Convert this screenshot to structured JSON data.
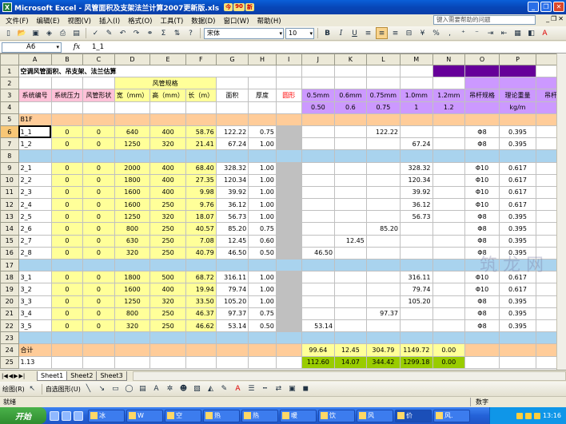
{
  "window": {
    "title": "Microsoft Excel - 风管面积及支架法兰计算2007更新版.xls",
    "badges": [
      "今",
      "90",
      "新"
    ]
  },
  "menu": [
    "文件(F)",
    "编辑(E)",
    "视图(V)",
    "插入(I)",
    "格式(O)",
    "工具(T)",
    "数据(D)",
    "窗口(W)",
    "帮助(H)"
  ],
  "help_placeholder": "键入需要帮助的问题",
  "toolbar": {
    "font": "宋体",
    "size": "10",
    "bold": "B",
    "italic": "I",
    "underline": "U",
    "percent": "%",
    "sigma": "Σ",
    "format_comma": ","
  },
  "formula": {
    "cell": "A6",
    "fx": "fx",
    "content": "1_1"
  },
  "col_headers": [
    "A",
    "B",
    "C",
    "D",
    "E",
    "F",
    "G",
    "H",
    "I",
    "J",
    "K",
    "L",
    "M",
    "N",
    "O",
    "P",
    ""
  ],
  "rows": [
    {
      "n": "1",
      "c": [
        {
          "t": "空调风管面积、吊支架、法兰估算",
          "cls": "l b",
          "span": 8
        },
        {
          "t": ""
        },
        {
          "t": ""
        },
        {
          "t": ""
        },
        {
          "t": ""
        },
        {
          "t": ""
        },
        {
          "t": "",
          "cls": "dp"
        },
        {
          "t": "",
          "cls": "dp"
        },
        {
          "t": "",
          "cls": "dp"
        }
      ]
    },
    {
      "n": "2",
      "c": [
        {
          "t": ""
        },
        {
          "t": ""
        },
        {
          "t": ""
        },
        {
          "t": "风管规格",
          "cls": "y",
          "span": 3
        },
        {
          "t": ""
        },
        {
          "t": ""
        },
        {
          "t": ""
        },
        {
          "t": ""
        },
        {
          "t": ""
        },
        {
          "t": ""
        },
        {
          "t": ""
        },
        {
          "t": ""
        },
        {
          "t": "",
          "cls": "lv"
        },
        {
          "t": "",
          "cls": "lv"
        },
        {
          "t": "",
          "cls": "lv"
        }
      ]
    },
    {
      "n": "3",
      "c": [
        {
          "t": "系统编号",
          "cls": "pk"
        },
        {
          "t": "系统压力",
          "cls": "pk"
        },
        {
          "t": "风管形状",
          "cls": "pk"
        },
        {
          "t": "宽（mm）",
          "cls": "y"
        },
        {
          "t": "高（mm）",
          "cls": "y"
        },
        {
          "t": "长（m）",
          "cls": "y"
        },
        {
          "t": "面积"
        },
        {
          "t": "厚度"
        },
        {
          "t": "圆形",
          "cls": "red"
        },
        {
          "t": "0.5mm",
          "cls": "lv"
        },
        {
          "t": "0.6mm",
          "cls": "lv"
        },
        {
          "t": "0.75mm",
          "cls": "lv"
        },
        {
          "t": "1.0mm",
          "cls": "lv"
        },
        {
          "t": "1.2mm",
          "cls": "lv"
        },
        {
          "t": "吊杆规格",
          "cls": "lv"
        },
        {
          "t": "理论重量",
          "cls": "lv"
        },
        {
          "t": "吊杆",
          "cls": "lv"
        }
      ]
    },
    {
      "n": "4",
      "c": [
        {
          "t": ""
        },
        {
          "t": ""
        },
        {
          "t": ""
        },
        {
          "t": ""
        },
        {
          "t": ""
        },
        {
          "t": ""
        },
        {
          "t": ""
        },
        {
          "t": ""
        },
        {
          "t": ""
        },
        {
          "t": "0.50",
          "cls": "lv"
        },
        {
          "t": "0.6",
          "cls": "lv"
        },
        {
          "t": "0.75",
          "cls": "lv"
        },
        {
          "t": "1",
          "cls": "lv"
        },
        {
          "t": "1.2",
          "cls": "lv"
        },
        {
          "t": "",
          "cls": "lv"
        },
        {
          "t": "kg/m",
          "cls": "lv"
        },
        {
          "t": "",
          "cls": "lv"
        }
      ]
    },
    {
      "n": "5",
      "band": "or",
      "c": [
        {
          "t": "B1F",
          "cls": "or l"
        }
      ]
    },
    {
      "n": "6",
      "v": [
        "1_1",
        "0",
        "0",
        "640",
        "400",
        "58.76",
        "122.22",
        "0.75",
        "",
        "",
        "",
        "122.22",
        "",
        "",
        "Φ8",
        "0.395"
      ]
    },
    {
      "n": "7",
      "v": [
        "1_2",
        "0",
        "0",
        "1250",
        "320",
        "21.41",
        "67.24",
        "1.00",
        "",
        "",
        "",
        "",
        "67.24",
        "",
        "Φ8",
        "0.395"
      ]
    },
    {
      "n": "8",
      "band": "bl"
    },
    {
      "n": "9",
      "v": [
        "2_1",
        "0",
        "0",
        "2000",
        "400",
        "68.40",
        "328.32",
        "1.00",
        "",
        "",
        "",
        "",
        "328.32",
        "",
        "Φ10",
        "0.617"
      ]
    },
    {
      "n": "10",
      "v": [
        "2_2",
        "0",
        "0",
        "1800",
        "400",
        "27.35",
        "120.34",
        "1.00",
        "",
        "",
        "",
        "",
        "120.34",
        "",
        "Φ10",
        "0.617"
      ]
    },
    {
      "n": "11",
      "v": [
        "2_3",
        "0",
        "0",
        "1600",
        "400",
        "9.98",
        "39.92",
        "1.00",
        "",
        "",
        "",
        "",
        "39.92",
        "",
        "Φ10",
        "0.617"
      ]
    },
    {
      "n": "12",
      "v": [
        "2_4",
        "0",
        "0",
        "1600",
        "250",
        "9.76",
        "36.12",
        "1.00",
        "",
        "",
        "",
        "",
        "36.12",
        "",
        "Φ10",
        "0.617"
      ]
    },
    {
      "n": "13",
      "v": [
        "2_5",
        "0",
        "0",
        "1250",
        "320",
        "18.07",
        "56.73",
        "1.00",
        "",
        "",
        "",
        "",
        "56.73",
        "",
        "Φ8",
        "0.395"
      ]
    },
    {
      "n": "14",
      "v": [
        "2_6",
        "0",
        "0",
        "800",
        "250",
        "40.57",
        "85.20",
        "0.75",
        "",
        "",
        "",
        "85.20",
        "",
        "",
        "Φ8",
        "0.395"
      ]
    },
    {
      "n": "15",
      "v": [
        "2_7",
        "0",
        "0",
        "630",
        "250",
        "7.08",
        "12.45",
        "0.60",
        "",
        "",
        "12.45",
        "",
        "",
        "",
        "Φ8",
        "0.395"
      ]
    },
    {
      "n": "16",
      "v": [
        "2_8",
        "0",
        "0",
        "320",
        "250",
        "40.79",
        "46.50",
        "0.50",
        "",
        "46.50",
        "",
        "",
        "",
        "",
        "Φ8",
        "0.395"
      ]
    },
    {
      "n": "17",
      "band": "bl"
    },
    {
      "n": "18",
      "v": [
        "3_1",
        "0",
        "0",
        "1800",
        "500",
        "68.72",
        "316.11",
        "1.00",
        "",
        "",
        "",
        "",
        "316.11",
        "",
        "Φ10",
        "0.617"
      ]
    },
    {
      "n": "19",
      "v": [
        "3_2",
        "0",
        "0",
        "1600",
        "400",
        "19.94",
        "79.74",
        "1.00",
        "",
        "",
        "",
        "",
        "79.74",
        "",
        "Φ10",
        "0.617"
      ]
    },
    {
      "n": "20",
      "v": [
        "3_3",
        "0",
        "0",
        "1250",
        "320",
        "33.50",
        "105.20",
        "1.00",
        "",
        "",
        "",
        "",
        "105.20",
        "",
        "Φ8",
        "0.395"
      ]
    },
    {
      "n": "21",
      "v": [
        "3_4",
        "0",
        "0",
        "800",
        "250",
        "46.37",
        "97.37",
        "0.75",
        "",
        "",
        "",
        "97.37",
        "",
        "",
        "Φ8",
        "0.395"
      ]
    },
    {
      "n": "22",
      "v": [
        "3_5",
        "0",
        "0",
        "320",
        "250",
        "46.62",
        "53.14",
        "0.50",
        "",
        "53.14",
        "",
        "",
        "",
        "",
        "Φ8",
        "0.395"
      ]
    },
    {
      "n": "23",
      "band": "bl"
    },
    {
      "n": "24",
      "band": "or",
      "c": [
        {
          "t": "合计",
          "cls": "or l"
        },
        {
          "t": "",
          "cls": "or"
        },
        {
          "t": "",
          "cls": "or"
        },
        {
          "t": "",
          "cls": "or"
        },
        {
          "t": "",
          "cls": "or"
        },
        {
          "t": "",
          "cls": "or"
        },
        {
          "t": "",
          "cls": "or"
        },
        {
          "t": "",
          "cls": "or"
        },
        {
          "t": "",
          "cls": "or"
        },
        {
          "t": "99.64",
          "cls": "y"
        },
        {
          "t": "12.45",
          "cls": "y"
        },
        {
          "t": "304.79",
          "cls": "y"
        },
        {
          "t": "1149.72",
          "cls": "y"
        },
        {
          "t": "0.00",
          "cls": "y"
        },
        {
          "t": "",
          "cls": "or"
        },
        {
          "t": "",
          "cls": "or"
        },
        {
          "t": "",
          "cls": "or"
        }
      ]
    },
    {
      "n": "25",
      "c": [
        {
          "t": "1.13",
          "cls": "l"
        },
        {
          "t": ""
        },
        {
          "t": ""
        },
        {
          "t": ""
        },
        {
          "t": ""
        },
        {
          "t": ""
        },
        {
          "t": ""
        },
        {
          "t": ""
        },
        {
          "t": ""
        },
        {
          "t": "112.60",
          "cls": "gr"
        },
        {
          "t": "14.07",
          "cls": "gr"
        },
        {
          "t": "344.42",
          "cls": "gr"
        },
        {
          "t": "1299.18",
          "cls": "gr"
        },
        {
          "t": "0.00",
          "cls": "gr"
        },
        {
          "t": ""
        },
        {
          "t": ""
        },
        {
          "t": ""
        }
      ]
    }
  ],
  "watermark": "筑 龙 网",
  "sheets": [
    "Sheet1",
    "Sheet2",
    "Sheet3"
  ],
  "drawbar": {
    "draw": "绘图(R)",
    "autoshape": "自选图形(U)"
  },
  "status": {
    "left": "就绪",
    "right": "数字"
  },
  "taskbar": {
    "start": "开始",
    "tasks": [
      "冰",
      "W",
      "空",
      "热",
      "热",
      "暖",
      "饮",
      "风",
      "价",
      "风."
    ],
    "clock": "13:16"
  }
}
